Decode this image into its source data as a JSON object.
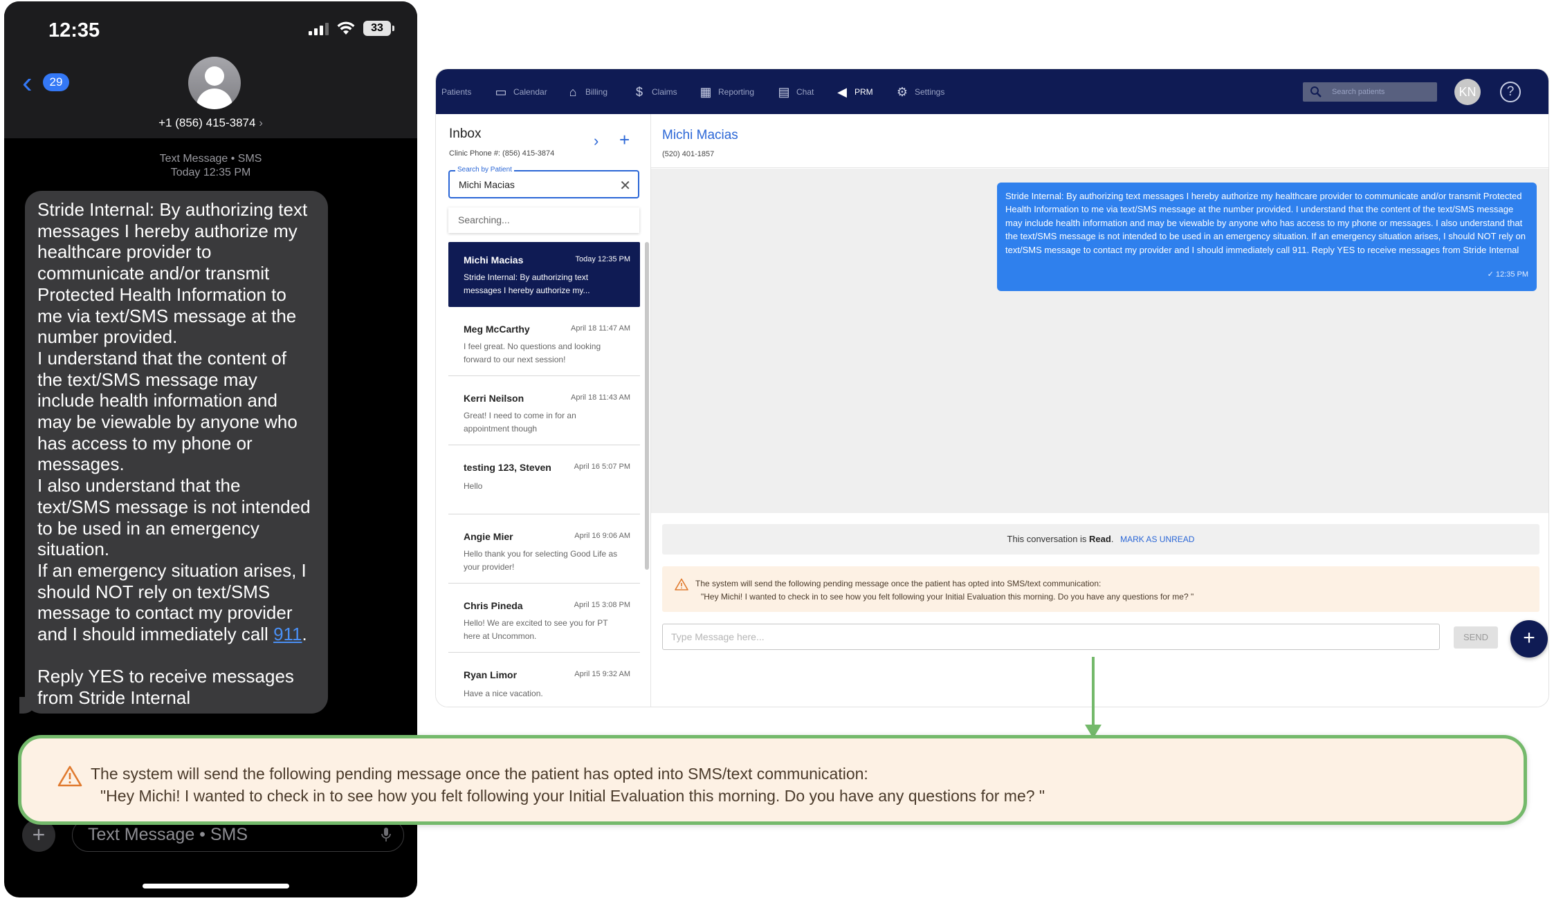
{
  "phone": {
    "status_time": "12:35",
    "battery": "33",
    "back_count": "29",
    "contact_number": "+1 (856) 415-3874",
    "contact_chevron": "›",
    "msg_meta_line1": "Text Message • SMS",
    "msg_meta_line2": "Today 12:35 PM",
    "message_before_link": "Stride Internal: By authorizing text messages I hereby authorize my healthcare provider to communicate and/or transmit Protected Health Information to me via text/SMS message at the number provided.\nI understand that the content of the text/SMS message may include health information and may be viewable by anyone who has access to my phone or messages.\nI also understand that the text/SMS message is not intended to be used in an emergency situation.\nIf an emergency situation arises, I should NOT rely on text/SMS message to contact my provider and I should immediately call ",
    "message_link": "911",
    "message_after_link": ".\n\nReply YES to receive messages from Stride Internal",
    "input_placeholder": "Text Message • SMS",
    "plus_label": "+"
  },
  "app": {
    "nav": [
      {
        "label": "Patients",
        "icon": "patients-icon",
        "glyph": ""
      },
      {
        "label": "Calendar",
        "icon": "calendar-icon",
        "glyph": "▭"
      },
      {
        "label": "Billing",
        "icon": "billing-icon",
        "glyph": "⌂"
      },
      {
        "label": "Claims",
        "icon": "dollar-icon",
        "glyph": "$"
      },
      {
        "label": "Reporting",
        "icon": "reporting-icon",
        "glyph": "▦"
      },
      {
        "label": "Chat",
        "icon": "chat-icon",
        "glyph": "▤"
      },
      {
        "label": "PRM",
        "icon": "megaphone-icon",
        "glyph": "◀"
      },
      {
        "label": "Settings",
        "icon": "gear-icon",
        "glyph": "⚙"
      }
    ],
    "search_placeholder": "Search patients",
    "avatar_initials": "KN",
    "help_glyph": "?",
    "inbox": {
      "title": "Inbox",
      "clinic_phone": "Clinic Phone #: (856) 415-3874",
      "chevron": "›",
      "plus": "+",
      "search_label": "Search by Patient",
      "search_value": "Michi Macias",
      "clear_glyph": "✕",
      "searching_text": "Searching..."
    },
    "conversations": [
      {
        "name": "Michi Macias",
        "time": "Today 12:35 PM",
        "snippet": "Stride Internal: By authorizing text messages I hereby authorize my...",
        "active": true
      },
      {
        "name": "Meg McCarthy",
        "time": "April 18 11:47 AM",
        "snippet": "I feel great. No questions and looking forward to our next session!",
        "active": false
      },
      {
        "name": "Kerri Neilson",
        "time": "April 18 11:43 AM",
        "snippet": "Great! I need to come in for an appointment though",
        "active": false
      },
      {
        "name": "testing 123, Steven",
        "time": "April 16 5:07 PM",
        "snippet": "Hello",
        "active": false
      },
      {
        "name": "Angie Mier",
        "time": "April 16 9:06 AM",
        "snippet": "Hello thank you for selecting Good Life as your provider!",
        "active": false
      },
      {
        "name": "Chris Pineda",
        "time": "April 15 3:08 PM",
        "snippet": "Hello! We are excited to see you for PT here at Uncommon.",
        "active": false
      },
      {
        "name": "Ryan Limor",
        "time": "April 15 9:32 AM",
        "snippet": "Have a nice vacation.",
        "active": false
      }
    ],
    "chat": {
      "name": "Michi Macias",
      "phone": "(520) 401-1857",
      "outgoing_text": "Stride Internal: By authorizing text messages I hereby authorize my healthcare provider to communicate and/or transmit Protected Health Information to me via text/SMS message at the number provided. I understand that the content of the text/SMS message may include health information and may be viewable by anyone who has access to my phone or messages. I also understand that the text/SMS message is not intended to be used in an emergency situation. If an emergency situation arises, I should NOT rely on text/SMS message to contact my provider and I should immediately call 911. Reply YES to receive messages from Stride Internal",
      "outgoing_time": "✓ 12:35 PM",
      "read_prefix": "This conversation is ",
      "read_state": "Read",
      "read_suffix": ".",
      "mark_unread": "MARK AS UNREAD",
      "pending_line1": "The system will send the following pending message once the patient has opted into SMS/text communication:",
      "pending_line2": "\"Hey Michi! I wanted to check in to see how you felt following your Initial Evaluation this morning. Do you have any questions for me? \"",
      "input_placeholder": "Type Message here...",
      "send_label": "SEND",
      "fab_label": "+"
    }
  },
  "colors": {
    "navbar": "#0f1b54",
    "accent": "#2a66d6",
    "outgoing_bubble": "#2f80ed",
    "pending_bg": "#fdf1e4",
    "warning": "#e07a2e",
    "callout_border": "#74b96b",
    "ios_blue": "#3478f6",
    "sms_bubble": "#3a3a3c"
  }
}
